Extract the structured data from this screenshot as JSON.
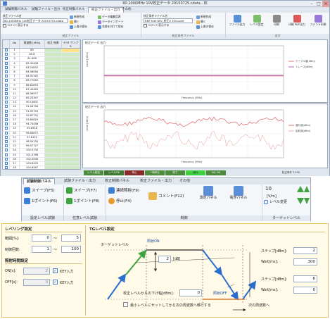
{
  "window": {
    "title": "80-1000MHz 10V校正データ 20150725.cdata - 校"
  },
  "tabs": [
    "試験制御パネル",
    "試験ファイル・出力",
    "校正制御パネル",
    "校正ファイル・出力",
    "その他"
  ],
  "ribbon_top": {
    "file_label": "校正ファイル名",
    "file_value": "80-1000MHz 10V校正データ 20150725.cdata",
    "btn_new": "新規作成",
    "btn_open": "開く",
    "btn_overwrite": "上書き保存",
    "btn_saveas": "名前を付けて保存",
    "btn_datalist": "データ編集用表",
    "btn_import": "データインポート",
    "group1": "校正ファイル",
    "file2_label": "校正条件ファイル名",
    "file2_value": "RNF test 80V_校正V 10V.cond",
    "grp2": "校正条件ファイル",
    "btn_levels": "ファイル出力",
    "btn_refs": "レベル設定",
    "btn_print": "印刷",
    "btn_pdf": "印刷 PDF出力",
    "btn_cmt": "コメント印刷",
    "grp3": "出力"
  },
  "grid": {
    "headers": [
      "",
      "No",
      "周波数 [MHz]",
      "校正 結果",
      "デ/タ サンプル"
    ],
    "rows": [
      [
        "1",
        "1",
        "80",
        "",
        ""
      ],
      [
        "1",
        "2",
        "80.8",
        "",
        ""
      ],
      [
        "1",
        "3",
        "81.608",
        "",
        ""
      ],
      [
        "1",
        "4",
        "82.42408",
        "",
        ""
      ],
      [
        "1",
        "5",
        "83.24832",
        "",
        ""
      ],
      [
        "1",
        "6",
        "84.08084",
        "",
        ""
      ],
      [
        "1",
        "7",
        "84.92162",
        "",
        ""
      ],
      [
        "1",
        "8",
        "85.77083",
        "",
        ""
      ],
      [
        "1",
        "9",
        "86.62854",
        "",
        ""
      ],
      [
        "1",
        "10",
        "87.49483",
        "",
        ""
      ],
      [
        "1",
        "11",
        "88.36977",
        "",
        ""
      ],
      [
        "1",
        "12",
        "89.25347",
        "",
        ""
      ],
      [
        "1",
        "13",
        "90.14601",
        "",
        ""
      ],
      [
        "1",
        "14",
        "91.04746",
        "",
        ""
      ],
      [
        "1",
        "15",
        "91.95794",
        "",
        ""
      ],
      [
        "1",
        "16",
        "92.87752",
        "",
        ""
      ],
      [
        "1",
        "17",
        "93.80629",
        "",
        ""
      ],
      [
        "1",
        "18",
        "94.74436",
        "",
        ""
      ],
      [
        "1",
        "19",
        "95.6918",
        "",
        ""
      ],
      [
        "1",
        "20",
        "96.64872",
        "",
        ""
      ],
      [
        "1",
        "21",
        "97.6152",
        "",
        ""
      ],
      [
        "1",
        "22",
        "98.59135",
        "",
        ""
      ],
      [
        "1",
        "23",
        "99.57727",
        "",
        ""
      ],
      [
        "1",
        "24",
        "100.5730",
        "",
        ""
      ],
      [
        "1",
        "25",
        "101.5788",
        "",
        ""
      ],
      [
        "1",
        "26",
        "102.5946",
        "",
        ""
      ],
      [
        "1",
        "27",
        "103.6205",
        "",
        ""
      ],
      [
        "1",
        "28",
        "104.6567",
        "",
        ""
      ],
      [
        "1",
        "29",
        "105.7033",
        "",
        ""
      ]
    ]
  },
  "chart1": {
    "title": "校正データ 出力",
    "ylabel": "Level [dBm]",
    "xlabel": "Frequency [MHz]",
    "legend": [
      "テーブル値(dBm)",
      "トレース(dBm)"
    ]
  },
  "chart2": {
    "title": "校正データ 出力",
    "ylabel": "Level [dBm]",
    "xlabel": "Frequency [MHz]",
    "legend": [
      "進行波(dBm)",
      "反射波(dBm)"
    ]
  },
  "statusbar": {
    "items": [
      "レベル設定",
      "レベルOK",
      "停止",
      "一時停止",
      "終了",
      "続行",
      "NG OK"
    ],
    "right": "校正条件 12:00"
  },
  "ribbon2": {
    "tabs": [
      "試験制御パネル",
      "試験ファイル・出力",
      "校正制御パネル",
      "校正ファイル・出力",
      "その他"
    ],
    "btn_sweep_f5": "スイープ(F5)",
    "btn_step_f6": "1ポイント(F6)",
    "btn_sweep_f7": "スイープ(F7)",
    "btn_step_f8": "1ポイント(F8)",
    "btn_auto": "連続照射(F9)",
    "btn_stop": "停止(F4)",
    "btn_comment": "コメント(F12)",
    "btn_measure": "測定パネル",
    "btn_field": "電界パネル",
    "level_value": "10",
    "level_unit": "[V/m]",
    "level_change": "レベル変更",
    "grp_test": "設定レベル試験",
    "grp_any": "任意レベル試験",
    "grp_ctrl": "制御",
    "grp_target": "ターゲットレベル"
  },
  "panel": {
    "level_settings": "レベリング設定",
    "range_label": "範囲[%]:",
    "range_from": "0",
    "range_to": "5",
    "count_label": "制御回数:",
    "count_from": "1",
    "count_to": "100",
    "tilde": "〜",
    "irradiation": "照射時間設定",
    "on_label": "ON[s]:",
    "on_value": "2",
    "off_label": "OFF[s]:",
    "off_value": "0",
    "key_input": "KEY入力",
    "tg_settings": "TGレベル設定",
    "target_level": "ターゲットレベル",
    "irr_on": "照射ON",
    "irr_off": "照射OFF",
    "db_value": "2",
    "db_unit": "[dB]",
    "down_label": "校正レベルからの下げ幅[dBm]:",
    "down_value": "0",
    "step_up_label": "ステップ[dBm]:",
    "step_up_value": "2",
    "wait_up_label": "Wait[ms]:",
    "wait_up_value": "300",
    "step_dn_label": "ステップ[dBm]:",
    "step_dn_value": "6",
    "wait_dn_label": "Wait[ms]:",
    "wait_dn_value": "0",
    "min_check": "最小レベルにセットしてから次の周波数へ移行する",
    "next_freq": "次の周波数へ"
  }
}
